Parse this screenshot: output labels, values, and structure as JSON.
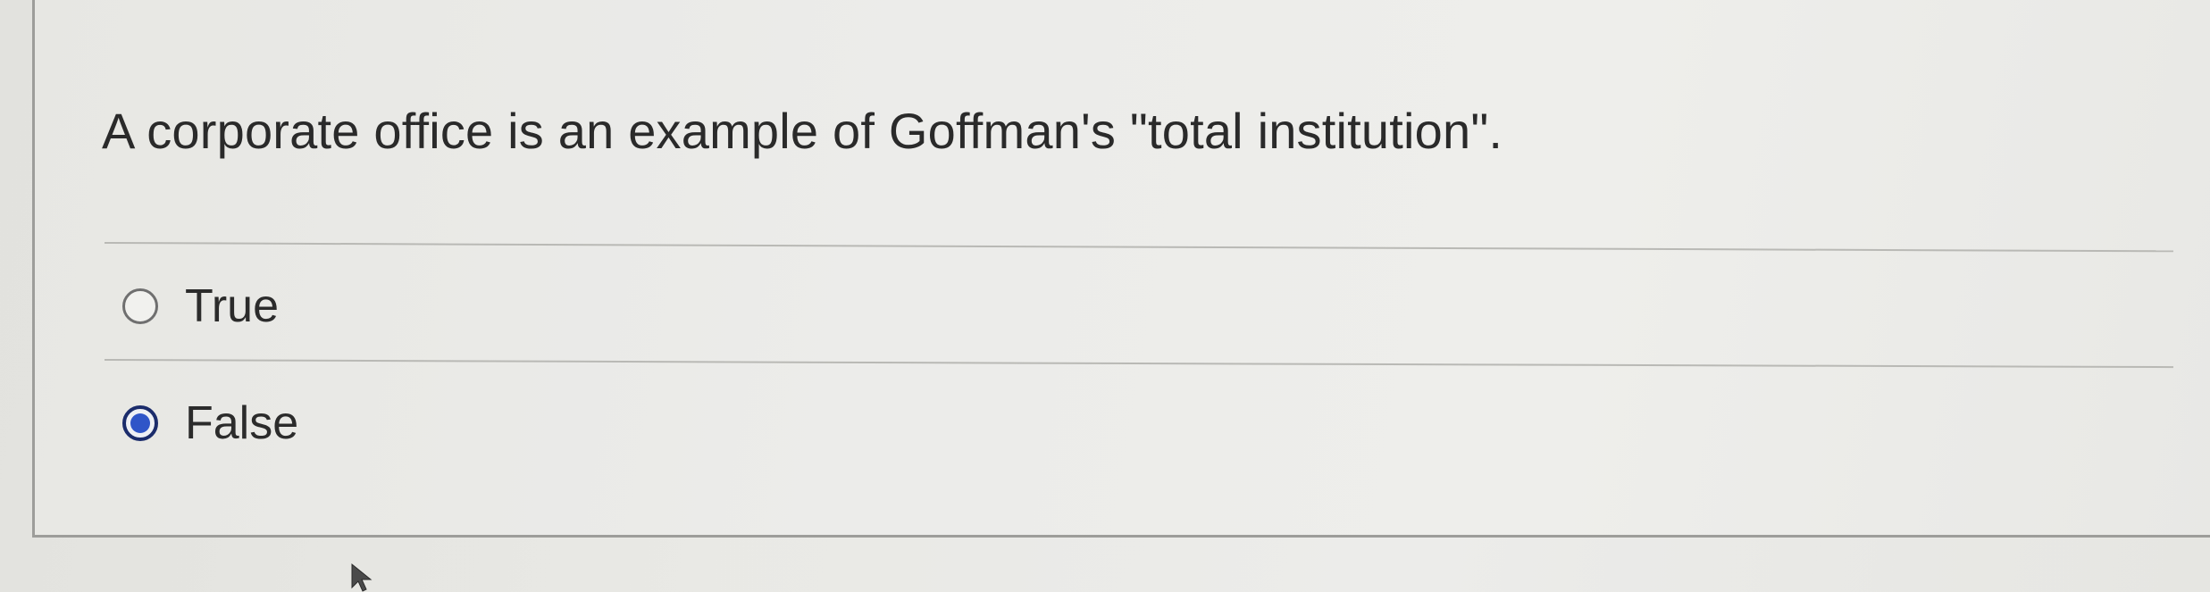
{
  "question": {
    "text": "A corporate office is an example of Goffman's \"total institution\"."
  },
  "options": [
    {
      "label": "True",
      "selected": false
    },
    {
      "label": "False",
      "selected": true
    }
  ],
  "colors": {
    "accent": "#2f55c8",
    "radio_selected_border": "#1b2c6b"
  },
  "icons": {
    "cursor": "mouse-pointer-icon"
  }
}
